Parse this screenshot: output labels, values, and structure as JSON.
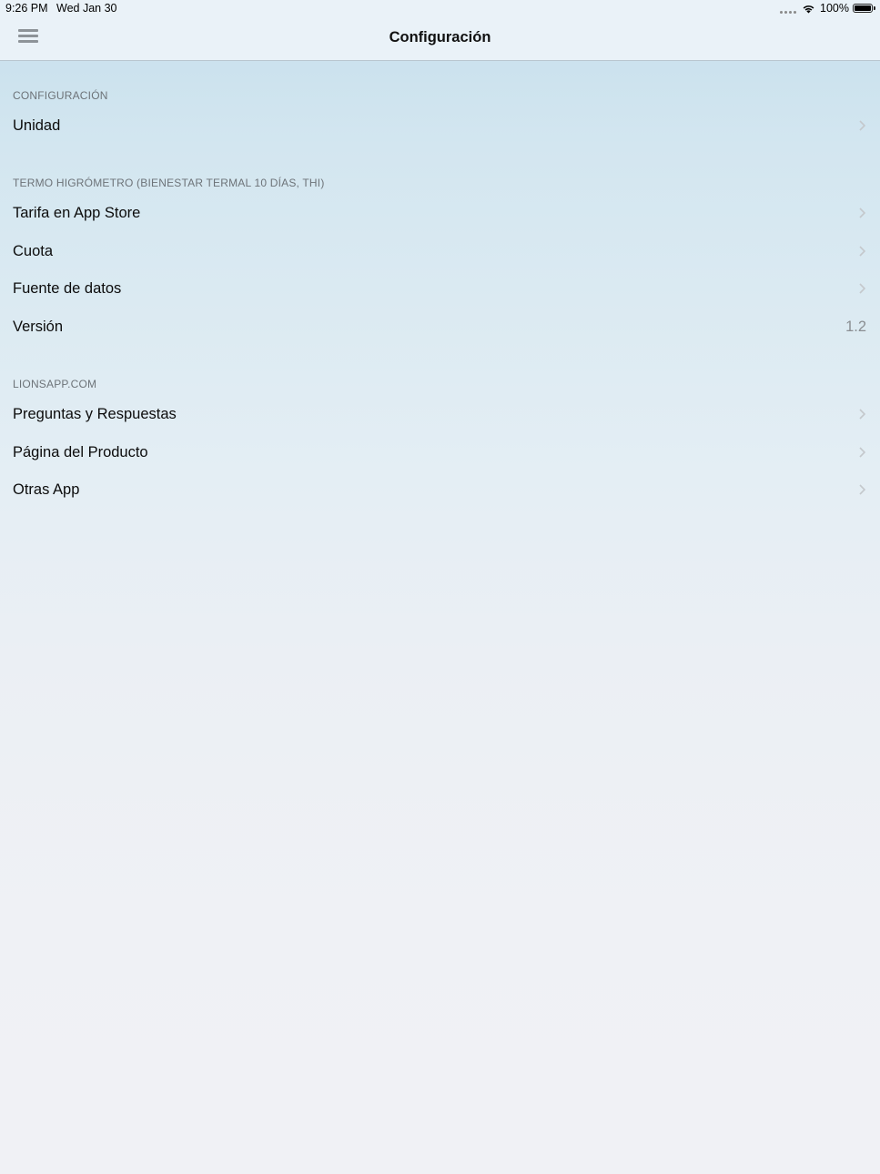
{
  "status_bar": {
    "time": "9:26 PM",
    "date": "Wed Jan 30",
    "battery": "100%",
    "battery_level": 1.0
  },
  "nav": {
    "title": "Configuración",
    "menu_icon": "hamburger-menu-icon"
  },
  "sections": [
    {
      "header": "CONFIGURACIÓN",
      "rows": [
        {
          "label": "Unidad",
          "accessory": "chevron-right-icon"
        }
      ]
    },
    {
      "header": "TERMO HIGRÓMETRO (BIENESTAR TERMAL 10 DÍAS, THI)",
      "rows": [
        {
          "label": "Tarifa en App Store",
          "accessory": "chevron-right-icon"
        },
        {
          "label": "Cuota",
          "accessory": "chevron-right-icon"
        },
        {
          "label": "Fuente de datos",
          "accessory": "chevron-right-icon"
        },
        {
          "label": "Versión",
          "value": "1.2"
        }
      ]
    },
    {
      "header": "LIONSAPP.COM",
      "rows": [
        {
          "label": "Preguntas y Respuestas",
          "accessory": "chevron-right-icon"
        },
        {
          "label": "Página del Producto",
          "accessory": "chevron-right-icon"
        },
        {
          "label": "Otras App",
          "accessory": "chevron-right-icon"
        }
      ]
    }
  ],
  "colors": {
    "accent_text": "#0c0c0c",
    "secondary_text": "#6d7378",
    "chevron": "#c4c8cc"
  }
}
